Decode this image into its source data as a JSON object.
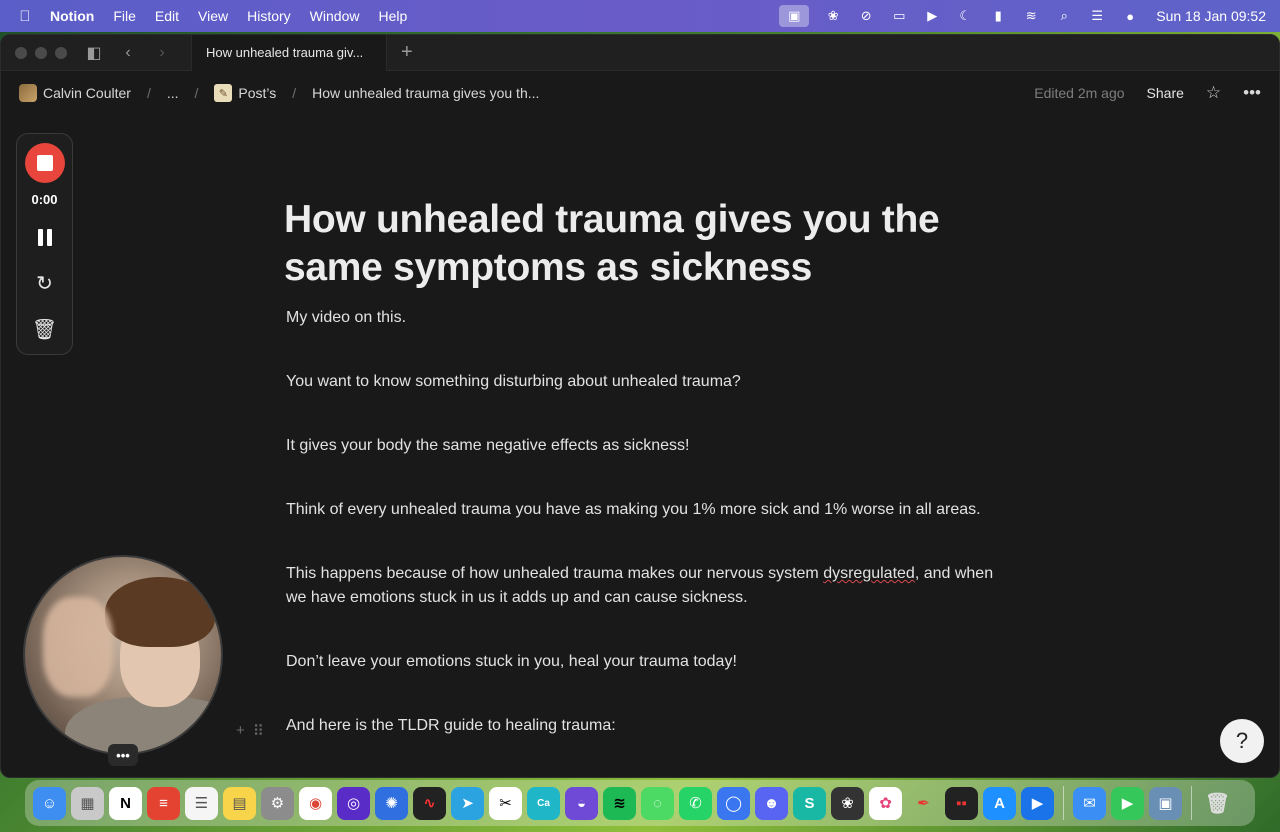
{
  "menubar": {
    "app_name": "Notion",
    "menus": [
      "File",
      "Edit",
      "View",
      "History",
      "Window",
      "Help"
    ],
    "clock": "Sun 18 Jan  09:52"
  },
  "tab": {
    "title": "How unhealed trauma giv...",
    "new_tab_symbol": "+"
  },
  "breadcrumb": {
    "workspace": "Calvin Coulter",
    "ellipsis": "...",
    "parent": "Post’s",
    "current": "How unhealed trauma gives you th..."
  },
  "topbar": {
    "edited": "Edited 2m ago",
    "share_label": "Share"
  },
  "recorder": {
    "time": "0:00"
  },
  "document": {
    "title": "How unhealed trauma gives you the same symptoms as sickness",
    "p1": "My video on this.",
    "p2": "You want to know something disturbing about unhealed trauma?",
    "p3": "It gives  your body the same negative effects as sickness!",
    "p4": "Think of every unhealed trauma you have as making you 1% more sick and 1% worse in all areas.",
    "p5_a": "This happens because of how unhealed trauma makes our nervous system ",
    "p5_b": "dysregulated",
    "p5_c": ", and when we have emotions stuck in us it adds up and can cause sickness.",
    "p6": "Don’t leave your emotions stuck in you, heal your trauma today!",
    "p7": "And here is the TLDR guide to healing trauma:"
  },
  "webcam": {
    "more_label": "•••"
  },
  "dock": {
    "apps": [
      "Finder",
      "Launchpad",
      "Notion",
      "Todoist",
      "Reminders",
      "Notes",
      "System Settings",
      "Chrome",
      "Arc",
      "Setapp",
      "Voice Memos",
      "Telegram",
      "CapCut",
      "Canva",
      "Proton VPN",
      "Spotify",
      "Messages",
      "WhatsApp",
      "Signal",
      "Discord",
      "Surfshark",
      "Hype",
      "Photos",
      "Quill",
      "Loom",
      "App Store",
      "Pages",
      "Mail",
      "FaceTime",
      "Preview",
      "Trash"
    ]
  },
  "colors": {
    "accent_stop": "#e8453c",
    "menubar": "#5b5ec8",
    "background": "#191919"
  }
}
